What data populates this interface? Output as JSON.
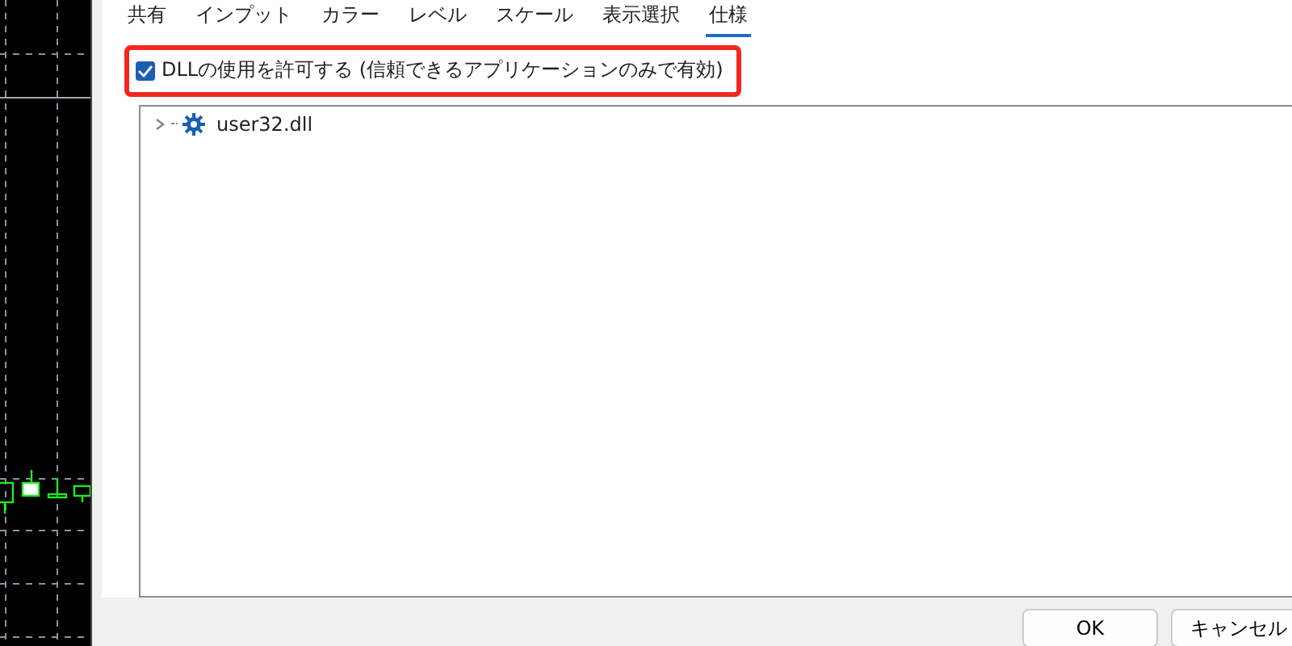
{
  "tabs": [
    {
      "label": "共有",
      "selected": false
    },
    {
      "label": "インプット",
      "selected": false
    },
    {
      "label": "カラー",
      "selected": false
    },
    {
      "label": "レベル",
      "selected": false
    },
    {
      "label": "スケール",
      "selected": false
    },
    {
      "label": "表示選択",
      "selected": false
    },
    {
      "label": "仕様",
      "selected": true
    }
  ],
  "allow_dll": {
    "label": "DLLの使用を許可する (信頼できるアプリケーションのみで有効)",
    "checked": true,
    "highlighted": true
  },
  "tree": [
    {
      "label": "user32.dll",
      "expanded": false
    }
  ],
  "buttons": [
    "OK",
    "キャンセル"
  ]
}
